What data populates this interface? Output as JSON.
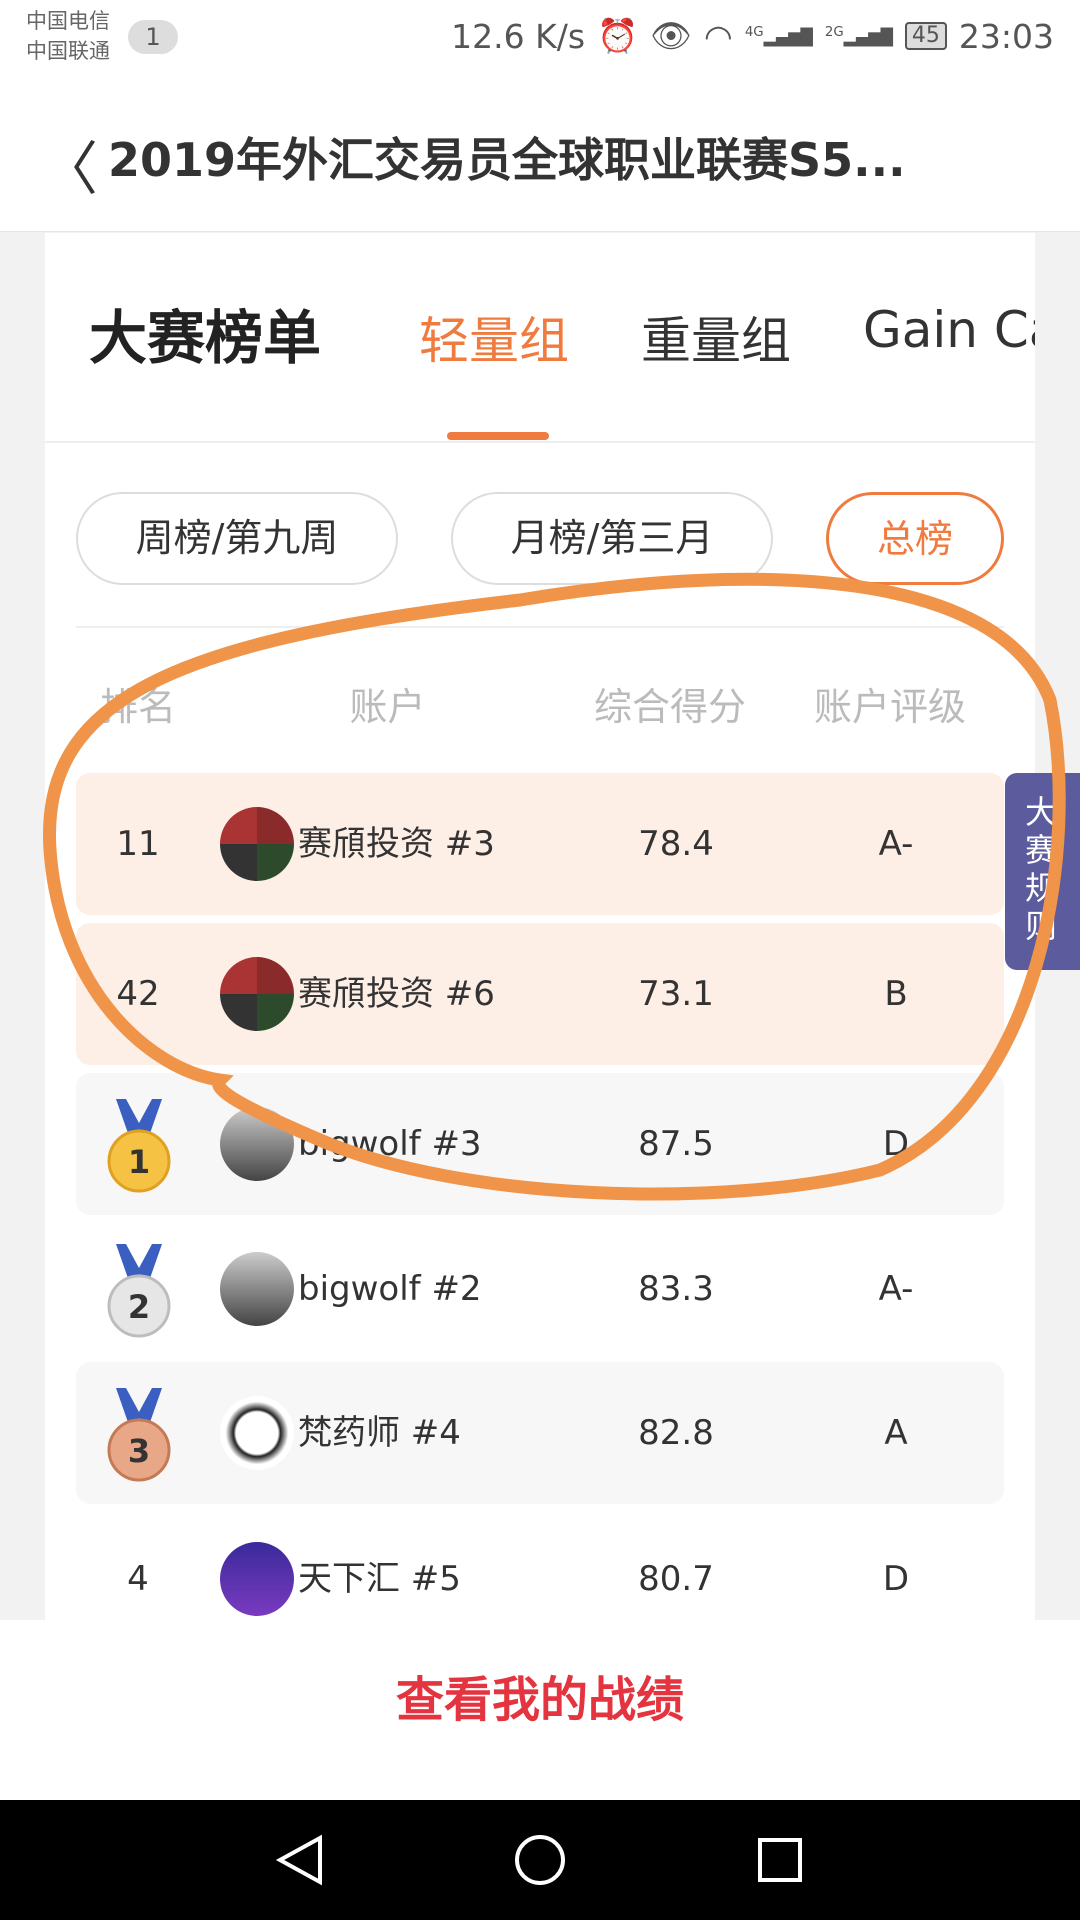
{
  "status_bar": {
    "carrier1": "中国电信",
    "carrier2": "中国联通",
    "notification_count": "1",
    "speed": "12.6 K/s",
    "net1": "4G",
    "net2": "2G",
    "battery": "45",
    "time": "23:03"
  },
  "header": {
    "title": "2019年外汇交易员全球职业联赛S5..."
  },
  "tabs": {
    "title": "大赛榜单",
    "items": [
      {
        "label": "轻量组",
        "active": true
      },
      {
        "label": "重量组"
      },
      {
        "label": "Gain Ca"
      }
    ]
  },
  "periods": [
    {
      "label": "周榜/第九周"
    },
    {
      "label": "月榜/第三月"
    },
    {
      "label": "总榜",
      "active": true
    }
  ],
  "columns": [
    "排名",
    "账户",
    "综合得分",
    "账户评级"
  ],
  "rows": [
    {
      "rank": "11",
      "name": "赛頎投资  #3",
      "score": "78.4",
      "rating": "A-",
      "highlight": true
    },
    {
      "rank": "42",
      "name": "赛頎投资  #6",
      "score": "73.1",
      "rating": "B",
      "highlight": true
    },
    {
      "rank": "1",
      "name": "bigwolf  #3",
      "score": "87.5",
      "rating": "D",
      "medal": "gold"
    },
    {
      "rank": "2",
      "name": "bigwolf  #2",
      "score": "83.3",
      "rating": "A-",
      "medal": "silver"
    },
    {
      "rank": "3",
      "name": "梵药师  #4",
      "score": "82.8",
      "rating": "A",
      "medal": "bronze"
    },
    {
      "rank": "4",
      "name": "天下汇  #5",
      "score": "80.7",
      "rating": "D"
    }
  ],
  "side_tab": "大赛规则",
  "bottom_button": "查看我的战绩",
  "colors": {
    "accent": "#f07b3f",
    "highlight_row": "#fdeee6",
    "side_tab": "#5b5b9e",
    "cta": "#e3343f",
    "annotation": "#f0944a"
  }
}
